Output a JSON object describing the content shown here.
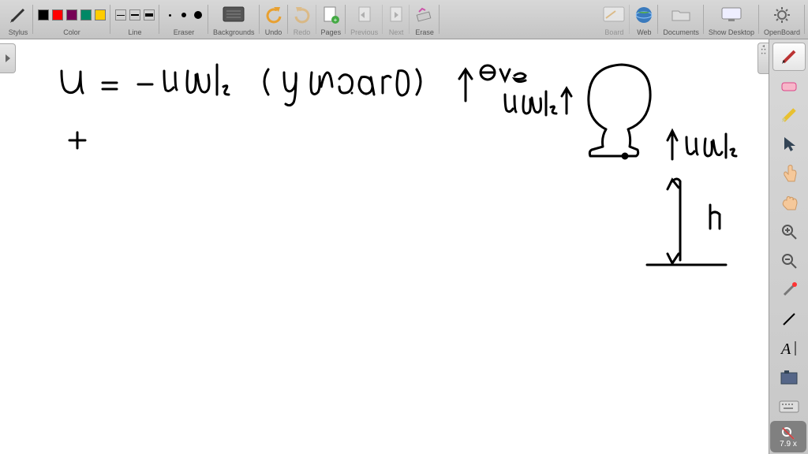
{
  "toolbar": {
    "stylus_label": "Stylus",
    "color_label": "Color",
    "line_label": "Line",
    "eraser_label": "Eraser",
    "backgrounds_label": "Backgrounds",
    "undo_label": "Undo",
    "redo_label": "Redo",
    "pages_label": "Pages",
    "previous_label": "Previous",
    "next_label": "Next",
    "erase_label": "Erase",
    "board_label": "Board",
    "web_label": "Web",
    "documents_label": "Documents",
    "show_desktop_label": "Show Desktop",
    "openboard_label": "OpenBoard",
    "colors": [
      "#000000",
      "#ff0000",
      "#770055",
      "#008866",
      "#ffcc00"
    ]
  },
  "zoom": {
    "value": "7.9 x"
  },
  "whiteboard": {
    "equation_text": "u = - 4 m/s",
    "annotation_text": "(upward)",
    "theta_label": "⊖ve",
    "velocity_label_left": "4m/s",
    "velocity_label_right": "4m/s",
    "height_label": "h",
    "plus_symbol": "+"
  }
}
